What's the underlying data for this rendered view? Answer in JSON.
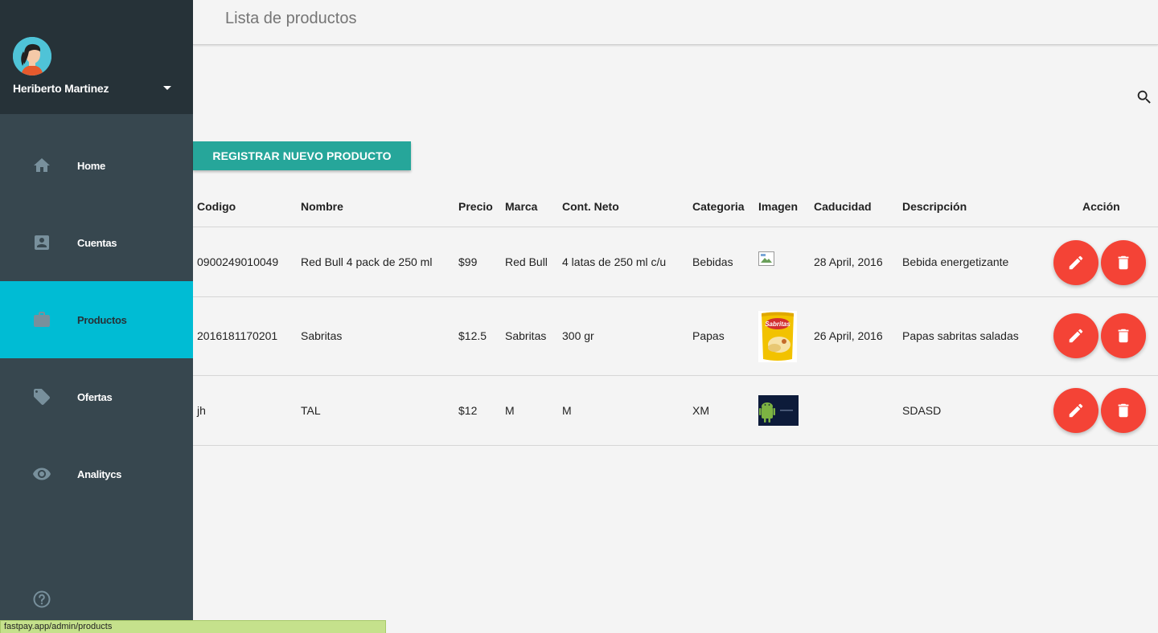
{
  "sidebar": {
    "user_name": "Heriberto Martinez",
    "avatar_icon": "user-avatar",
    "items": [
      {
        "label": "Home",
        "icon": "home-icon",
        "active": false
      },
      {
        "label": "Cuentas",
        "icon": "account-box-icon",
        "active": false
      },
      {
        "label": "Productos",
        "icon": "work-icon",
        "active": true
      },
      {
        "label": "Ofertas",
        "icon": "tag-icon",
        "active": false
      },
      {
        "label": "Analitycs",
        "icon": "eye-icon",
        "active": false
      }
    ],
    "help_icon": "help-icon"
  },
  "header": {
    "title": "Lista de productos"
  },
  "toolbar": {
    "register_label": "REGISTRAR NUEVO PRODUCTO",
    "search_icon": "search-icon"
  },
  "table": {
    "columns": [
      "Codigo",
      "Nombre",
      "Precio",
      "Marca",
      "Cont. Neto",
      "Categoria",
      "Imagen",
      "Caducidad",
      "Descripción",
      "Acción"
    ],
    "rows": [
      {
        "codigo": "0900249010049",
        "nombre": "Red Bull 4 pack de 250 ml",
        "precio": "$99",
        "marca": "Red Bull",
        "cont_neto": "4 latas de 250 ml c/u",
        "categoria": "Bebidas",
        "imagen": "broken-image",
        "caducidad": "28 April, 2016",
        "descripcion": "Bebida energetizante"
      },
      {
        "codigo": "2016181170201",
        "nombre": "Sabritas",
        "precio": "$12.5",
        "marca": "Sabritas",
        "cont_neto": "300 gr",
        "categoria": "Papas",
        "imagen": "chips-bag-image",
        "imagen_text": "Sabritas",
        "caducidad": "26 April, 2016",
        "descripcion": "Papas sabritas saladas"
      },
      {
        "codigo": "jh",
        "nombre": "TAL",
        "precio": "$12",
        "marca": "M",
        "cont_neto": "M",
        "categoria": "XM",
        "imagen": "android-image",
        "caducidad": "",
        "descripcion": "SDASD"
      }
    ],
    "actions": {
      "edit_icon": "pencil-icon",
      "delete_icon": "trash-icon"
    }
  },
  "status_bar": {
    "url": "fastpay.app/admin/products"
  },
  "colors": {
    "sidebar": "#37474f",
    "sidebar_header": "#263238",
    "active": "#00bcd4",
    "primary_button": "#26a69a",
    "fab": "#f44336",
    "status_bar": "#c5e18c"
  }
}
